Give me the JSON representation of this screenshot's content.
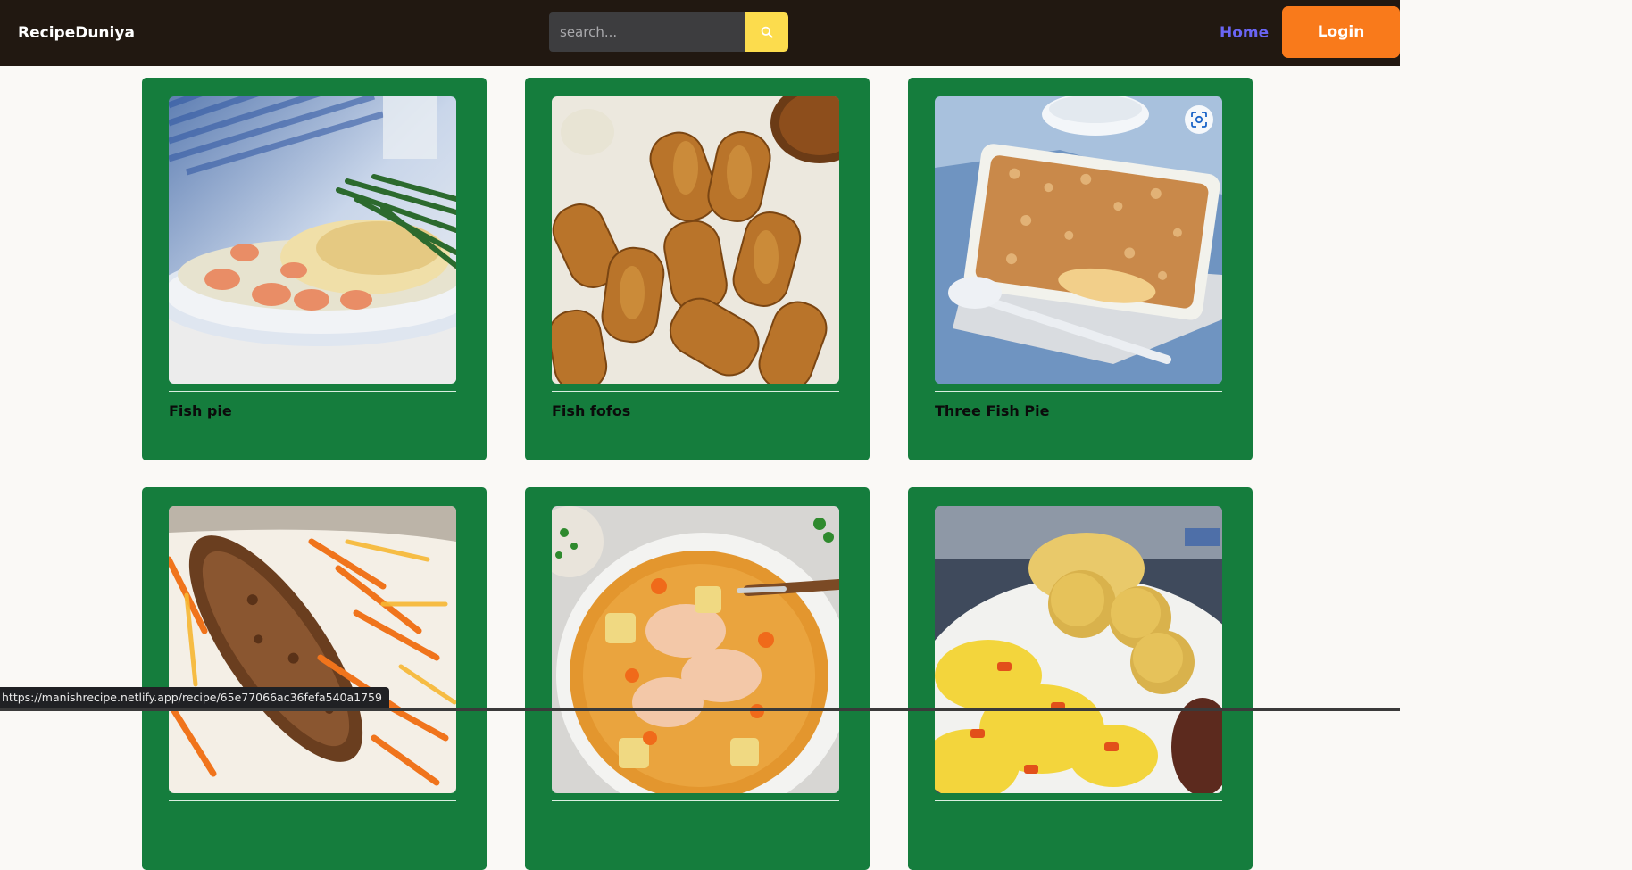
{
  "brand": {
    "name": "RecipeDuniya"
  },
  "search": {
    "placeholder": "search..."
  },
  "nav": {
    "home_label": "Home",
    "login_label": "Login"
  },
  "colors": {
    "navbar_bg": "#211811",
    "card_bg": "#157d3d",
    "search_button": "#fcdc4d",
    "login_button": "#f97a1b",
    "home_link": "#6a65f4"
  },
  "recipes": [
    {
      "title": "Fish pie",
      "image": "fish-pie-photo"
    },
    {
      "title": "Fish fofos",
      "image": "fish-fofos-photo"
    },
    {
      "title": "Three Fish Pie",
      "image": "three-fish-pie-photo"
    },
    {
      "title": "",
      "image": "fried-fish-with-peppers-photo"
    },
    {
      "title": "",
      "image": "salmon-soup-photo"
    },
    {
      "title": "",
      "image": "ackee-saltfish-dumplings-photo"
    }
  ],
  "status_bar": {
    "url": "https://manishrecipe.netlify.app/recipe/65e77066ac36fefa540a1759"
  }
}
